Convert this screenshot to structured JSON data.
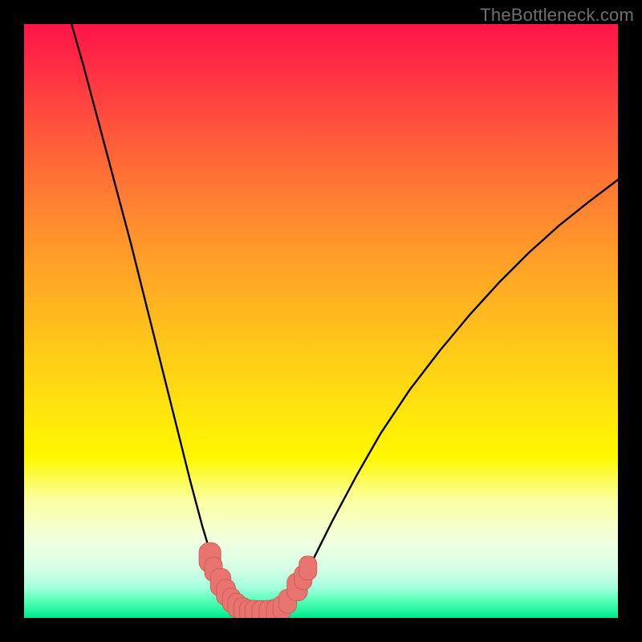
{
  "watermark": {
    "text": "TheBottleneck.com"
  },
  "colors": {
    "background": "#000000",
    "curve_stroke": "#000000",
    "marker_fill": "#e7746f",
    "marker_stroke": "#c55852"
  },
  "chart_data": {
    "type": "line",
    "title": "",
    "xlabel": "",
    "ylabel": "",
    "xlim": [
      0,
      100
    ],
    "ylim": [
      0,
      100
    ],
    "curves": {
      "left": {
        "description": "steep descending curve from top-left into the trough",
        "x": [
          8,
          10,
          12,
          14,
          16,
          18,
          20,
          22,
          24,
          26,
          28,
          30,
          31.5,
          33,
          34.5,
          36,
          37,
          38
        ],
        "y": [
          100,
          93,
          85.5,
          78,
          70.5,
          63,
          55,
          47,
          39,
          31,
          23,
          15.5,
          10.5,
          6.7,
          4.0,
          2.3,
          1.3,
          0.9
        ]
      },
      "right": {
        "description": "ascending curve from the trough toward upper-right",
        "x": [
          42,
          43.5,
          45,
          47,
          49,
          52,
          56,
          60,
          65,
          70,
          75,
          80,
          85,
          90,
          95,
          100
        ],
        "y": [
          0.9,
          1.8,
          3.5,
          6.5,
          10.5,
          16.5,
          24,
          31,
          38.5,
          45,
          51,
          56.5,
          61.5,
          66,
          70,
          73.8
        ]
      },
      "trough": {
        "description": "flat bottom segment",
        "x": [
          38,
          39.5,
          41,
          42
        ],
        "y": [
          0.9,
          0.75,
          0.75,
          0.9
        ]
      }
    },
    "markers": {
      "description": "pink rounded markers clustered near the trough",
      "points": [
        {
          "x": 31.3,
          "y": 10.2,
          "r": 1.6
        },
        {
          "x": 31.9,
          "y": 8.2,
          "r": 1.3
        },
        {
          "x": 33.1,
          "y": 6.0,
          "r": 1.5
        },
        {
          "x": 34.0,
          "y": 4.3,
          "r": 1.4
        },
        {
          "x": 34.9,
          "y": 3.0,
          "r": 1.3
        },
        {
          "x": 35.8,
          "y": 2.1,
          "r": 1.3
        },
        {
          "x": 36.8,
          "y": 1.4,
          "r": 1.3
        },
        {
          "x": 37.8,
          "y": 1.0,
          "r": 1.3
        },
        {
          "x": 38.8,
          "y": 0.8,
          "r": 1.4
        },
        {
          "x": 40.0,
          "y": 0.75,
          "r": 1.4
        },
        {
          "x": 41.2,
          "y": 0.8,
          "r": 1.4
        },
        {
          "x": 42.3,
          "y": 1.1,
          "r": 1.3
        },
        {
          "x": 43.4,
          "y": 1.7,
          "r": 1.3
        },
        {
          "x": 44.4,
          "y": 2.8,
          "r": 1.3
        },
        {
          "x": 46.0,
          "y": 5.2,
          "r": 1.5
        },
        {
          "x": 47.0,
          "y": 6.8,
          "r": 1.3
        },
        {
          "x": 47.8,
          "y": 8.4,
          "r": 1.3
        }
      ]
    }
  }
}
